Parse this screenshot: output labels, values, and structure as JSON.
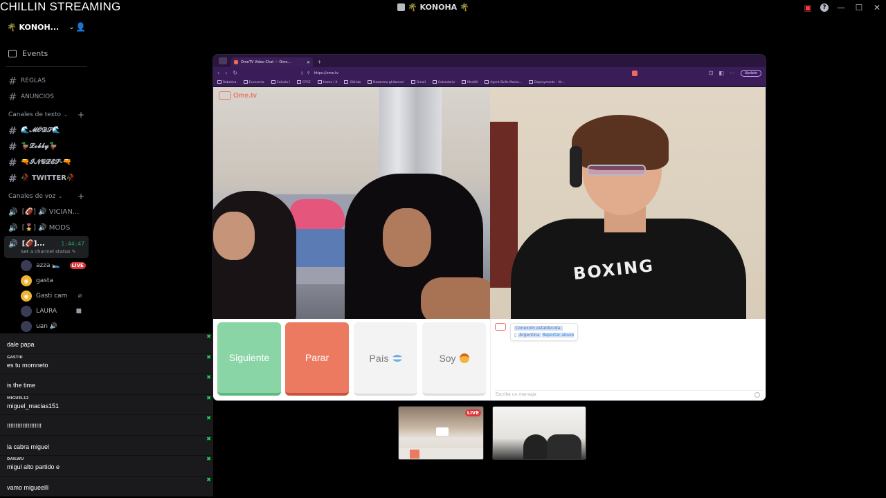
{
  "stream_title": "CHILLIN STREAMING",
  "window": {
    "title": "🌴 KONOHA 🌴"
  },
  "sidebar": {
    "server_name": "🌴 KONOH...",
    "events_label": "Events",
    "info_channels": [
      {
        "name": "REGLAS"
      },
      {
        "name": "ANUNCIOS"
      }
    ],
    "text_category": "Canales de texto",
    "text_channels": [
      {
        "name": "🌊𝓜𝓞𝓓𝓢🌊"
      },
      {
        "name": "🦆𝓛𝓸𝓫𝓫𝔂🦆"
      },
      {
        "name": "🔫𝓘𝓝𝓖𝓛𝓔𝓢-🔫"
      },
      {
        "name": "🥀 TWITTER🥀"
      }
    ],
    "voice_category": "Canales de voz",
    "voice_channels": [
      {
        "name": "[🏈] 🔊 VICIAN..."
      },
      {
        "name": "[🎖️] 🔊 MODS"
      }
    ],
    "active_voice": {
      "name": "[🏈]...",
      "timer": "1:44:47",
      "status": "Set a channel status ✎"
    },
    "voice_users": [
      {
        "name": "azza 🛌",
        "live": "LIVE"
      },
      {
        "name": "gasta"
      },
      {
        "name": "Gasti cam"
      },
      {
        "name": "LAURA"
      },
      {
        "name": "uan 🔊"
      }
    ]
  },
  "chat_overlay": [
    {
      "user": "",
      "text": "dale papa",
      "color": "red"
    },
    {
      "user": "GASTIII",
      "text": "es tu momneto",
      "color": "gray"
    },
    {
      "user": "",
      "text": "is the time",
      "color": "red"
    },
    {
      "user": "MIGUEL12",
      "text": "miguel_macias151",
      "color": "gray"
    },
    {
      "user": "",
      "text": "!!!!!!!!!!!!!!!!!!!!",
      "color": "red"
    },
    {
      "user": "",
      "text": "la cabra miguel",
      "color": "blue"
    },
    {
      "user": "DAILWU",
      "text": "migul alto partido e",
      "color": "gray"
    },
    {
      "user": "",
      "text": "vamo migueelll",
      "color": "red"
    }
  ],
  "browser": {
    "tab_title": "OmeTV Video Chat — Ome...",
    "url": "https://ome.tv",
    "update_label": "Update",
    "bookmarks": [
      "Robotica",
      "Economia",
      "Calculo I",
      "CPCE",
      "Home / X",
      "GitHub",
      "Nazareno ghitarroni",
      "Gmail",
      "Calendario",
      "Medifé",
      "Agent Skills Marke...",
      "Deployments - Ve..."
    ]
  },
  "ometv": {
    "logo": "Ome.tv",
    "buttons": {
      "next": "Siguiente",
      "stop": "Parar",
      "country": "País",
      "gender": "Soy"
    },
    "chat": {
      "connected": "Conexión establecida.",
      "country": "Argentina",
      "report": "Reportar abuso",
      "placeholder": "Escribe un mensaje"
    },
    "shirt_text": "BOXING"
  },
  "thumbnails": {
    "live_label": "LIVE"
  },
  "colors": {
    "live_red": "#da373c",
    "online_green": "#23a55a",
    "next_green": "#8ad5a5",
    "stop_orange": "#ec7a61",
    "ometv_purple": "#3a1d58"
  }
}
